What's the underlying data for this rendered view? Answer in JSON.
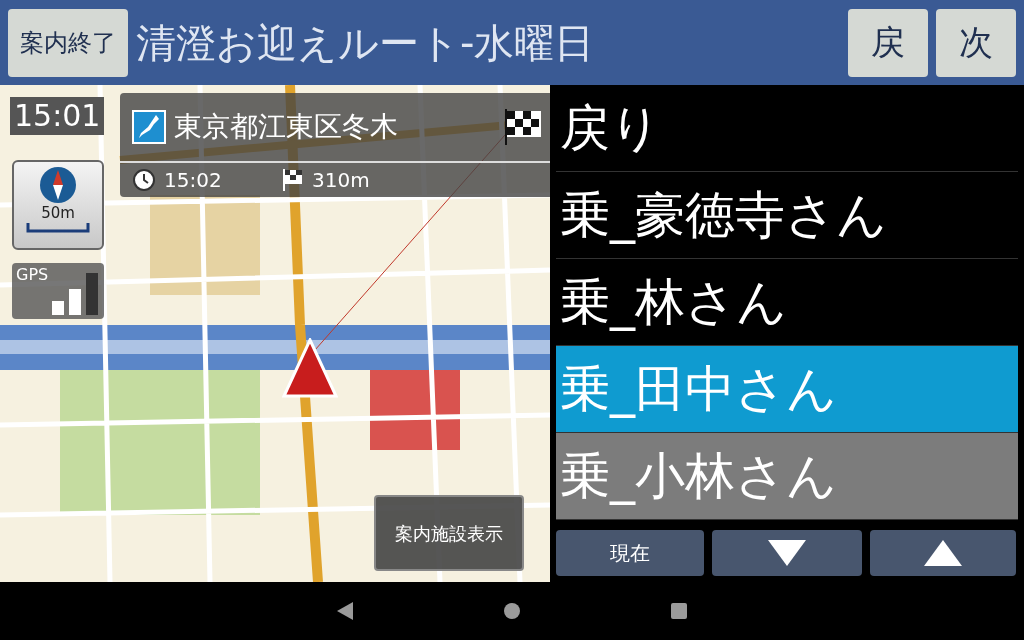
{
  "header": {
    "end_button": "案内終了",
    "title": "清澄お迎えルート-水曜日",
    "prev_button": "戻",
    "next_button": "次"
  },
  "map": {
    "time": "15:01",
    "destination": {
      "address": "東京都江東区冬木",
      "arrival": "15:02",
      "distance": "310m"
    },
    "scale": "50m",
    "gps": "GPS",
    "facility_button": "案内施設表示"
  },
  "stops": [
    {
      "label": "戻り",
      "selected": false
    },
    {
      "label": "乗_豪徳寺さん",
      "selected": false
    },
    {
      "label": "乗_林さん",
      "selected": false
    },
    {
      "label": "乗_田中さん",
      "selected": true
    },
    {
      "label": "乗_小林さん",
      "selected": false
    }
  ],
  "controls": {
    "current_button": "現在"
  }
}
